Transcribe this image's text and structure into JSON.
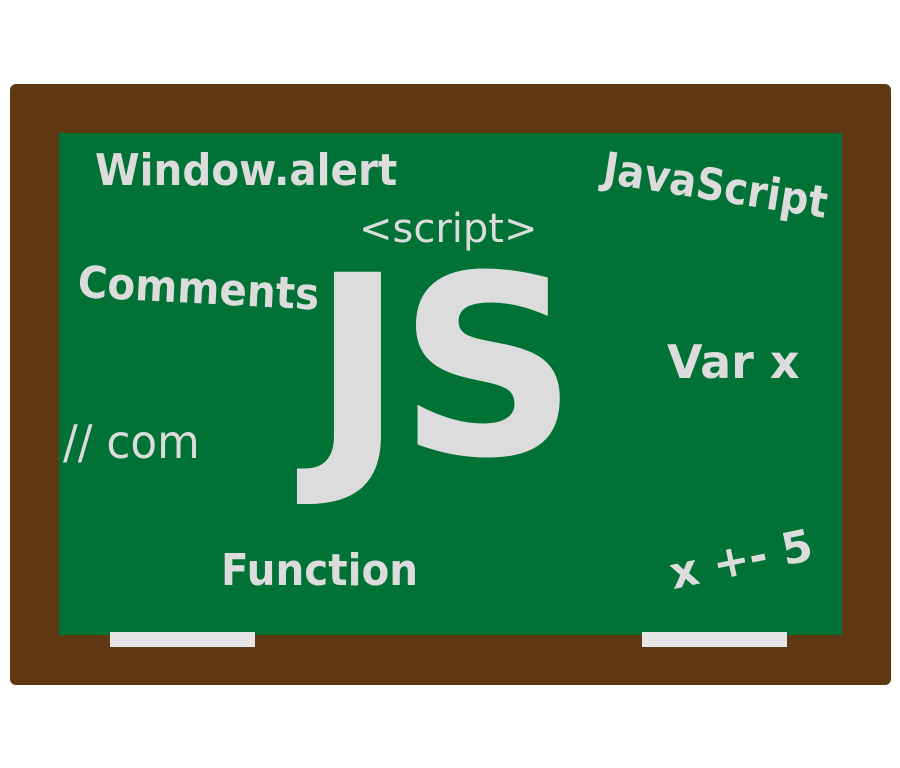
{
  "board": {
    "words": {
      "window_alert": "Window.alert",
      "script_tag": "<script>",
      "javascript": "JavaScript",
      "comments": "Comments",
      "js_logo": "JS",
      "var_x": "Var x",
      "comment_line": "// com",
      "function": "Function",
      "expression": "x +- 5"
    }
  },
  "colors": {
    "frame": "#603813",
    "board": "#007236",
    "chalk": "#dcdcdc",
    "chalk_stick": "#e6e6e6"
  }
}
